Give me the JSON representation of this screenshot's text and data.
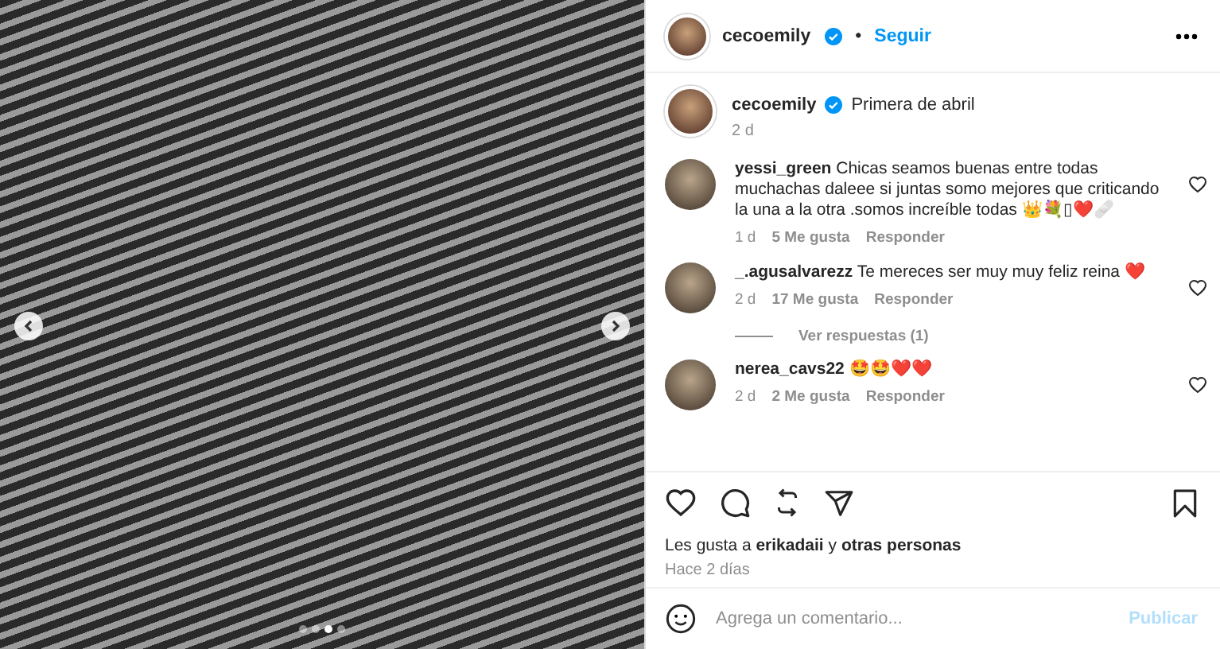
{
  "photo": {
    "dots": [
      {
        "selected": false
      },
      {
        "selected": false
      },
      {
        "selected": true
      },
      {
        "selected": false
      }
    ]
  },
  "header": {
    "username": "cecoemily",
    "verified": true,
    "separator": "•",
    "follow": "Seguir"
  },
  "caption": {
    "username": "cecoemily",
    "verified": true,
    "text": "Primera de abril",
    "time": "2 d"
  },
  "comments": [
    {
      "username": "yessi_green",
      "text": "Chicas seamos buenas entre todas muchachas daleee si juntas somo mejores que criticando la una a la otra .somos increíble todas 👑💐▯❤️🩹",
      "time": "1 d",
      "likes": "5 Me gusta",
      "reply": "Responder"
    },
    {
      "username": "_.agusalvarezz",
      "text": "Te mereces ser muy muy feliz reina ❤️",
      "time": "2 d",
      "likes": "17 Me gusta",
      "reply": "Responder",
      "view_replies": "Ver respuestas (1)"
    },
    {
      "username": "nerea_cavs22",
      "text": "🤩🤩❤️❤️",
      "time": "2 d",
      "likes": "2 Me gusta",
      "reply": "Responder"
    }
  ],
  "likes_text": "Les gusta a **erikadaii** y **otras personas**",
  "posted": "Hace 2 días",
  "comment_field": {
    "placeholder": "Agrega un comentario...",
    "submit": "Publicar"
  }
}
